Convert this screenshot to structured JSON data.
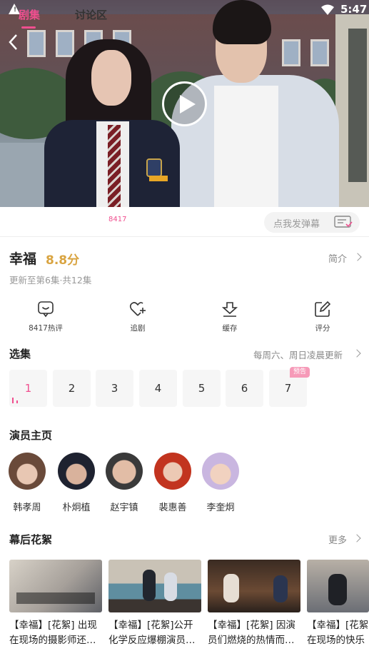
{
  "status_bar": {
    "time": "5:47"
  },
  "tabs": {
    "episodes_label": "剧集",
    "discussion_label": "讨论区",
    "discussion_count": "8417",
    "danmu_placeholder": "点我发弹幕"
  },
  "show": {
    "title": "幸福",
    "score": "8.8分",
    "intro_label": "简介",
    "update_info": "更新至第6集·共12集"
  },
  "actions": [
    {
      "label": "8417热评",
      "icon": "comment-icon"
    },
    {
      "label": "追剧",
      "icon": "heart-plus-icon"
    },
    {
      "label": "缓存",
      "icon": "download-icon"
    },
    {
      "label": "评分",
      "icon": "edit-icon"
    }
  ],
  "episodes": {
    "title": "选集",
    "schedule": "每周六、周日凌晨更新",
    "items": [
      "1",
      "2",
      "3",
      "4",
      "5",
      "6",
      "7"
    ],
    "current": "1",
    "preview_tag": "预告"
  },
  "cast": {
    "title": "演员主页",
    "members": [
      "韩孝周",
      "朴炯植",
      "赵宇镇",
      "裴惠善",
      "李奎炯"
    ]
  },
  "extras": {
    "title": "幕后花絮",
    "more_label": "更多",
    "clips": [
      {
        "caption": "【幸福】[花絮] 出现\n在现场的摄影师还…"
      },
      {
        "caption": "【幸福】[花絮]公开\n化学反应爆棚演员…"
      },
      {
        "caption": "【幸福】[花絮] 因演\n员们燃烧的热情而…"
      },
      {
        "caption": "【幸福】[花絮\n在现场的快乐"
      }
    ]
  },
  "colors": {
    "accent": "#f04f8f",
    "score": "#d9a441"
  }
}
